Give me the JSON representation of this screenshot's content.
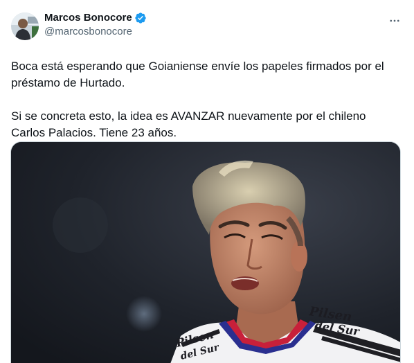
{
  "author": {
    "display_name": "Marcos Bonocore",
    "handle": "@marcosbonocore",
    "verified": true,
    "avatar_icon": "person-avatar"
  },
  "tweet": {
    "paragraphs": [
      "Boca está esperando que Goianiense envíe los papeles firmados por el préstamo de Hurtado.",
      "Si se concreta esto, la idea es AVANZAR nuevamente por el chileno Carlos Palacios. Tiene 23 años."
    ]
  },
  "media": {
    "kind": "photo",
    "jersey_sponsor_left": "Pilsen del Sur",
    "jersey_sponsor_right": "Pilsen del Sur"
  },
  "icons": {
    "verified": "verified-badge-icon",
    "more": "more-options-icon"
  },
  "colors": {
    "verified_blue": "#1d9bf0",
    "handle_gray": "#536471",
    "text": "#0f1419"
  }
}
